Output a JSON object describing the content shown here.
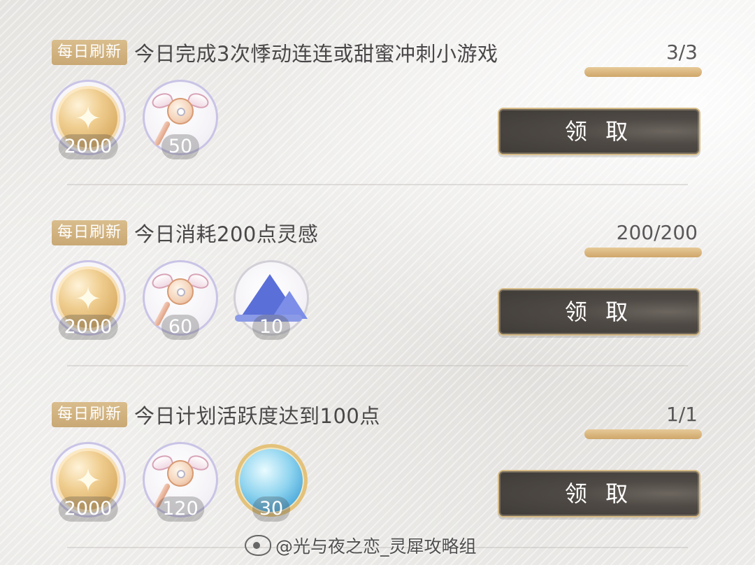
{
  "tasks": [
    {
      "tag": "每日刷新",
      "title": "今日完成3次悸动连连或甜蜜冲刺小游戏",
      "progress_text": "3/3",
      "progress_fraction": 1.0,
      "claim_label": "领 取",
      "rewards": [
        {
          "icon": "gold-coin-icon",
          "count": "2000"
        },
        {
          "icon": "heart-wand-icon",
          "count": "50"
        }
      ]
    },
    {
      "tag": "每日刷新",
      "title": "今日消耗200点灵感",
      "progress_text": "200/200",
      "progress_fraction": 1.0,
      "claim_label": "领 取",
      "rewards": [
        {
          "icon": "gold-coin-icon",
          "count": "2000"
        },
        {
          "icon": "heart-wand-icon",
          "count": "60"
        },
        {
          "icon": "blue-crystal-icon",
          "count": "10"
        }
      ]
    },
    {
      "tag": "每日刷新",
      "title": "今日计划活跃度达到100点",
      "progress_text": "1/1",
      "progress_fraction": 1.0,
      "claim_label": "领 取",
      "rewards": [
        {
          "icon": "gold-coin-icon",
          "count": "2000"
        },
        {
          "icon": "heart-wand-icon",
          "count": "120"
        },
        {
          "icon": "blue-orb-icon",
          "count": "30"
        }
      ]
    }
  ],
  "watermark": "@光与夜之恋_灵犀攻略组",
  "colors": {
    "tag_bg": "#d2b380",
    "button_bg": "#4a4540",
    "button_border": "#d6bb87",
    "progress": "#ddb983"
  }
}
